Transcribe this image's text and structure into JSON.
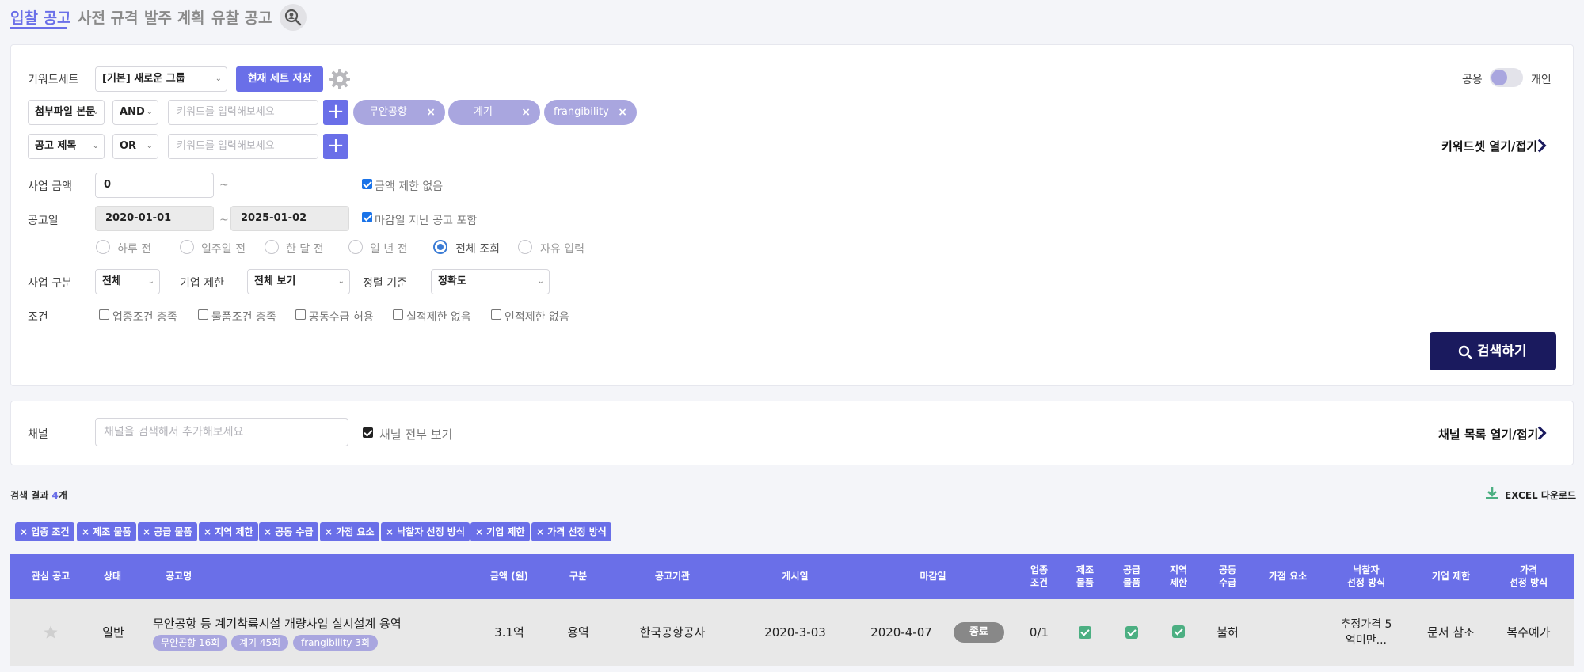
{
  "tabs": [
    {
      "label": "입찰 공고",
      "active": true
    },
    {
      "label": "사전 규격",
      "active": false
    },
    {
      "label": "발주 계획",
      "active": false
    },
    {
      "label": "유찰 공고",
      "active": false
    }
  ],
  "keyword_set": {
    "label": "키워드세트",
    "selected": "[기본] 새로운 그룹",
    "save_button": "현재 세트 저장",
    "settings_icon": "gear-icon",
    "scope_left": "공용",
    "scope_right": "개인",
    "toggle_link": "키워드셋 열기/접기"
  },
  "keyword_rows": [
    {
      "field": "첨부파일 본문",
      "operator": "AND",
      "placeholder": "키워드를 입력해보세요",
      "chips": [
        "무안공항",
        "계기",
        "frangibility"
      ]
    },
    {
      "field": "공고 제목",
      "operator": "OR",
      "placeholder": "키워드를 입력해보세요",
      "chips": []
    }
  ],
  "amount": {
    "label": "사업 금액",
    "min": "0",
    "tilde": "~",
    "no_limit_label": "금액 제한 없음",
    "no_limit": true
  },
  "date": {
    "label": "공고일",
    "from": "2020-01-01",
    "tilde": "~",
    "to": "2025-01-02",
    "include_closed_label": "마감일 지난 공고 포함",
    "include_closed": true
  },
  "date_presets": {
    "options": [
      "하루 전",
      "일주일 전",
      "한 달 전",
      "일 년 전",
      "전체 조회",
      "자유 입력"
    ],
    "selected": "전체 조회"
  },
  "business_type": {
    "label": "사업 구분",
    "value": "전체"
  },
  "company_limit": {
    "label": "기업 제한",
    "value": "전체 보기"
  },
  "sort": {
    "label": "정렬 기준",
    "value": "정확도"
  },
  "conditions": {
    "label": "조건",
    "options": [
      "업종조건 충족",
      "물품조건 충족",
      "공동수급 허용",
      "실적제한 없음",
      "인적제한 없음"
    ]
  },
  "search_button": "검색하기",
  "channel": {
    "label": "채널",
    "placeholder": "채널을 검색해서 추가해보세요",
    "show_all_label": "채널 전부 보기",
    "show_all": true,
    "toggle_link": "채널 목록 열기/접기"
  },
  "results": {
    "prefix": "검색 결과 ",
    "count": "4",
    "suffix": "개",
    "excel_label": "EXCEL 다운로드"
  },
  "filter_tags": [
    "업종 조건",
    "제조 물품",
    "공급 물품",
    "지역 제한",
    "공동 수급",
    "가점 요소",
    "낙찰자 선정 방식",
    "기업 제한",
    "가격 선정 방식"
  ],
  "table": {
    "headers": {
      "fav": "관심 공고",
      "status": "상태",
      "name": "공고명",
      "amount": "금액 (원)",
      "type": "구분",
      "agency": "공고기관",
      "posted": "게시일",
      "deadline": "마감일",
      "industry": [
        "업종",
        "조건"
      ],
      "mfg": [
        "제조",
        "물품"
      ],
      "supply": [
        "공급",
        "물품"
      ],
      "region": [
        "지역",
        "제한"
      ],
      "joint": [
        "공동",
        "수급"
      ],
      "bonus": "가점 요소",
      "winner": [
        "낙찰자",
        "선정 방식"
      ],
      "company": "기업 제한",
      "price": [
        "가격",
        "선정 방식"
      ]
    },
    "rows": [
      {
        "starred": false,
        "status": "일반",
        "name": "무안공항 등 계기착륙시설 개량사업 실시설계 용역",
        "keyword_hits": [
          "무안공항 16회",
          "계기 45회",
          "frangibility 3회"
        ],
        "amount": "3.1억",
        "type": "용역",
        "agency": "한국공항공사",
        "posted": "2020-3-03",
        "deadline": "2020-4-07",
        "deadline_badge": "종료",
        "industry": "0/1",
        "mfg": true,
        "supply": true,
        "region": true,
        "joint": "불허",
        "bonus": "",
        "winner": [
          "추정가격 5",
          "억미만..."
        ],
        "company": "문서 참조",
        "price": "복수예가"
      }
    ]
  },
  "colors": {
    "accent": "#6a6fe8",
    "chip": "#a9a6df",
    "navy": "#1a1a5e",
    "green": "#4caf82"
  }
}
